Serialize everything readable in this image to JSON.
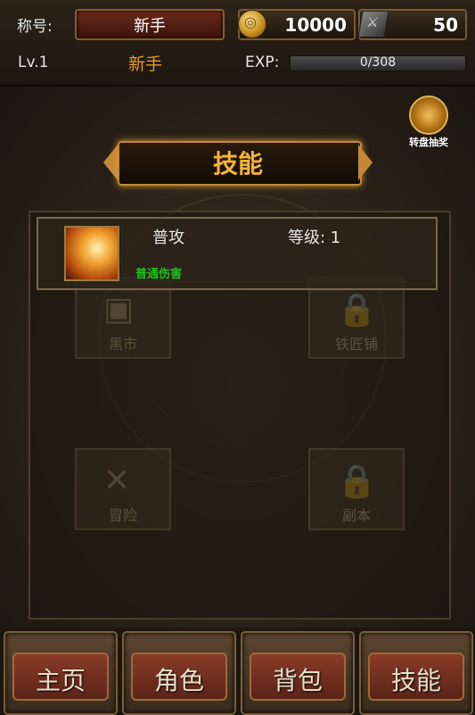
{
  "top": {
    "title_label": "称号:",
    "title_value": "新手",
    "gold": "10000",
    "gems": "50",
    "level": "Lv.1",
    "rank": "新手",
    "exp_label": "EXP:",
    "exp_text": "0/308",
    "exp_progress": 0
  },
  "lottery": {
    "label": "转盘抽奖"
  },
  "page": {
    "title": "技能"
  },
  "skills": [
    {
      "name": "普攻",
      "level": "等级: 1",
      "desc": "普通伤害"
    }
  ],
  "background_tiles": [
    "黑市",
    "铁匠铺",
    "冒险",
    "副本"
  ],
  "nav": [
    {
      "label": "主页"
    },
    {
      "label": "角色"
    },
    {
      "label": "背包"
    },
    {
      "label": "技能"
    }
  ],
  "colors": {
    "accent": "#f3b33a",
    "desc_green": "#20c020",
    "rank_orange": "#e59a25"
  }
}
